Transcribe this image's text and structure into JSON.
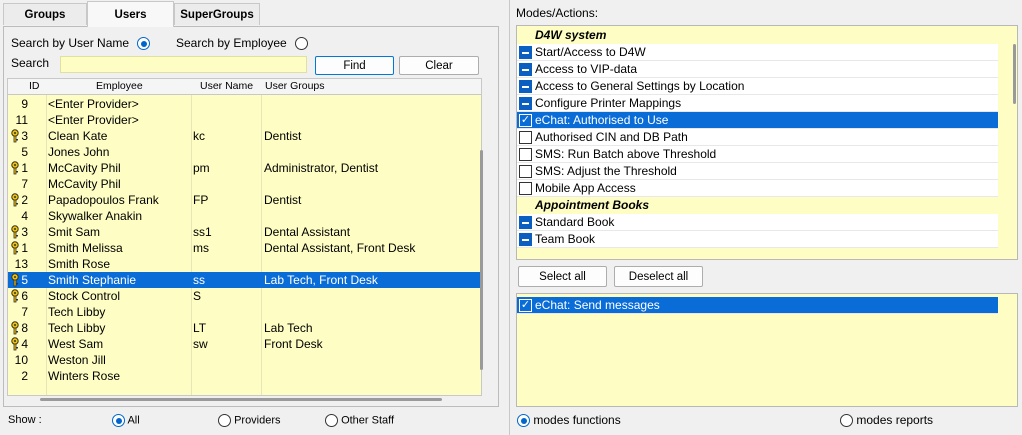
{
  "tabs": [
    "Groups",
    "Users",
    "SuperGroups"
  ],
  "search": {
    "by_user_name": "Search by User Name",
    "by_employee": "Search by Employee",
    "label": "Search",
    "value": "",
    "find": "Find",
    "clear": "Clear"
  },
  "grid": {
    "headers": {
      "id": "ID",
      "employee": "Employee",
      "username": "User Name",
      "groups": "User Groups"
    },
    "rows": [
      {
        "key": false,
        "id": "9",
        "employee": "<Enter Provider>",
        "username": "",
        "groups": ""
      },
      {
        "key": false,
        "id": "11",
        "employee": "<Enter Provider>",
        "username": "",
        "groups": ""
      },
      {
        "key": true,
        "id": "3",
        "employee": "Clean Kate",
        "username": "kc",
        "groups": "Dentist"
      },
      {
        "key": false,
        "id": "5",
        "employee": "Jones John",
        "username": "",
        "groups": ""
      },
      {
        "key": true,
        "id": "1",
        "employee": "McCavity Phil",
        "username": "pm",
        "groups": "Administrator, Dentist"
      },
      {
        "key": false,
        "id": "7",
        "employee": "McCavity Phil",
        "username": "",
        "groups": ""
      },
      {
        "key": true,
        "id": "2",
        "employee": "Papadopoulos Frank",
        "username": "FP",
        "groups": "Dentist"
      },
      {
        "key": false,
        "id": "4",
        "employee": "Skywalker Anakin",
        "username": "",
        "groups": ""
      },
      {
        "key": true,
        "id": "3",
        "employee": "Smit Sam",
        "username": "ss1",
        "groups": "Dental Assistant"
      },
      {
        "key": true,
        "id": "1",
        "employee": "Smith Melissa",
        "username": "ms",
        "groups": "Dental Assistant, Front Desk"
      },
      {
        "key": false,
        "id": "13",
        "employee": "Smith Rose",
        "username": "",
        "groups": ""
      },
      {
        "key": true,
        "id": "5",
        "employee": "Smith Stephanie",
        "username": "ss",
        "groups": "Lab Tech, Front Desk",
        "selected": true
      },
      {
        "key": true,
        "id": "6",
        "employee": "Stock  Control",
        "username": "S",
        "groups": ""
      },
      {
        "key": false,
        "id": "7",
        "employee": "Tech Libby",
        "username": "",
        "groups": ""
      },
      {
        "key": true,
        "id": "8",
        "employee": "Tech Libby",
        "username": "LT",
        "groups": "Lab Tech"
      },
      {
        "key": true,
        "id": "4",
        "employee": "West Sam",
        "username": "sw",
        "groups": "Front Desk"
      },
      {
        "key": false,
        "id": "10",
        "employee": "Weston Jill",
        "username": "",
        "groups": ""
      },
      {
        "key": false,
        "id": "2",
        "employee": "Winters Rose",
        "username": "",
        "groups": ""
      }
    ]
  },
  "show": {
    "label": "Show :",
    "all": "All",
    "providers": "Providers",
    "other": "Other Staff"
  },
  "modes": {
    "title": "Modes/Actions:",
    "items": [
      {
        "type": "cat",
        "text": "D4W system"
      },
      {
        "type": "item",
        "state": "minus",
        "text": "Start/Access to D4W"
      },
      {
        "type": "item",
        "state": "minus",
        "text": "Access to VIP-data"
      },
      {
        "type": "item",
        "state": "minus",
        "text": "Access to General Settings by Location"
      },
      {
        "type": "item",
        "state": "minus",
        "text": "Configure Printer Mappings"
      },
      {
        "type": "item",
        "state": "check",
        "text": "eChat: Authorised to Use",
        "selected": true
      },
      {
        "type": "item",
        "state": "empty",
        "text": "Authorised CIN and DB Path"
      },
      {
        "type": "item",
        "state": "empty",
        "text": "SMS: Run Batch above Threshold"
      },
      {
        "type": "item",
        "state": "empty",
        "text": "SMS: Adjust the Threshold"
      },
      {
        "type": "item",
        "state": "empty",
        "text": "Mobile App Access"
      },
      {
        "type": "cat",
        "text": "Appointment Books"
      },
      {
        "type": "item",
        "state": "minus",
        "text": "Standard Book"
      },
      {
        "type": "item",
        "state": "minus",
        "text": "Team Book"
      }
    ],
    "select_all": "Select all",
    "deselect_all": "Deselect all",
    "sub_items": [
      {
        "text": "eChat: Send messages",
        "state": "check",
        "selected": true
      }
    ],
    "functions": "modes functions",
    "reports": "modes reports"
  }
}
